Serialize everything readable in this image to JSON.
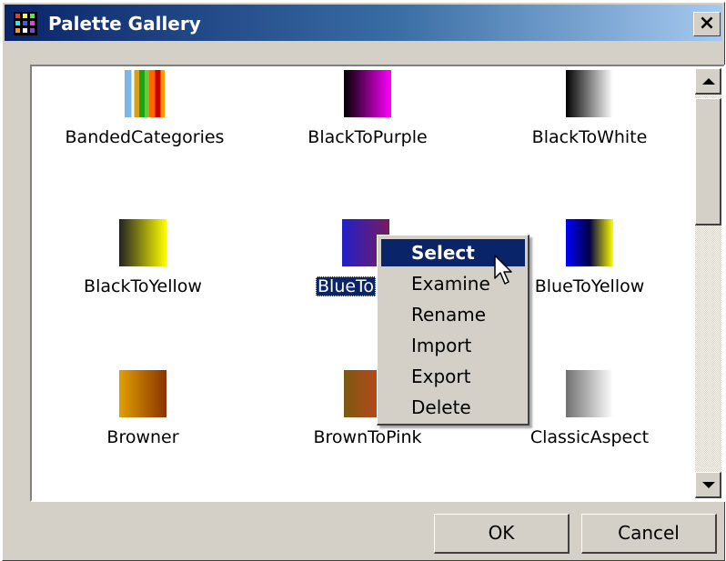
{
  "window": {
    "title": "Palette Gallery",
    "close_glyph": "×"
  },
  "gallery": {
    "items": [
      {
        "label": "BandedCategories",
        "gradient": "linear-gradient(to right,#ffffff 0 8%,#7ab7e8 8% 22%,#ffffff 22% 28%,#d4a017 28% 38%,#1aa01a 38% 50%,#66cc33 50% 60%,#ff6600 60% 72%,#cc0000 72% 84%,#ff9900 84% 92%,#ffffff 92% 100%)"
      },
      {
        "label": "BlackToPurple",
        "gradient": "linear-gradient(to right,#000000,#ff00ff)"
      },
      {
        "label": "BlackToWhite",
        "gradient": "linear-gradient(to right,#000000,#ffffff)"
      },
      {
        "label": "BlackToYellow",
        "gradient": "linear-gradient(to right,#222222,#ffff00)"
      },
      {
        "label": "BlueTo",
        "gradient": "linear-gradient(to right,#2020c8,#7a1a60)"
      },
      {
        "label": "BlueToYellow",
        "gradient": "linear-gradient(to right,#0000ff 0%,#000044 50%,#ffff00 100%)"
      },
      {
        "label": "Browner",
        "gradient": "linear-gradient(to right,#e0a000,#8a3300)"
      },
      {
        "label": "BrownToPink",
        "gradient": "linear-gradient(to right,#7a5a10,#d04020)"
      },
      {
        "label": "ClassicAspect",
        "gradient": "linear-gradient(to right,#707070,#ffffff)"
      }
    ]
  },
  "context_menu": {
    "items": [
      {
        "label": "Select"
      },
      {
        "label": "Examine"
      },
      {
        "label": "Rename"
      },
      {
        "label": "Import"
      },
      {
        "label": "Export"
      },
      {
        "label": "Delete"
      }
    ]
  },
  "buttons": {
    "ok": "OK",
    "cancel": "Cancel"
  },
  "icons": {
    "app": "palette-grid-icon",
    "close": "close-icon",
    "scroll_up": "arrow-up-icon",
    "scroll_down": "arrow-down-icon",
    "cursor": "mouse-pointer-icon"
  },
  "colors": {
    "titlebar_start": "#0a246a",
    "titlebar_end": "#a6caf0",
    "selection": "#0a246a",
    "face": "#d4d0c8"
  }
}
